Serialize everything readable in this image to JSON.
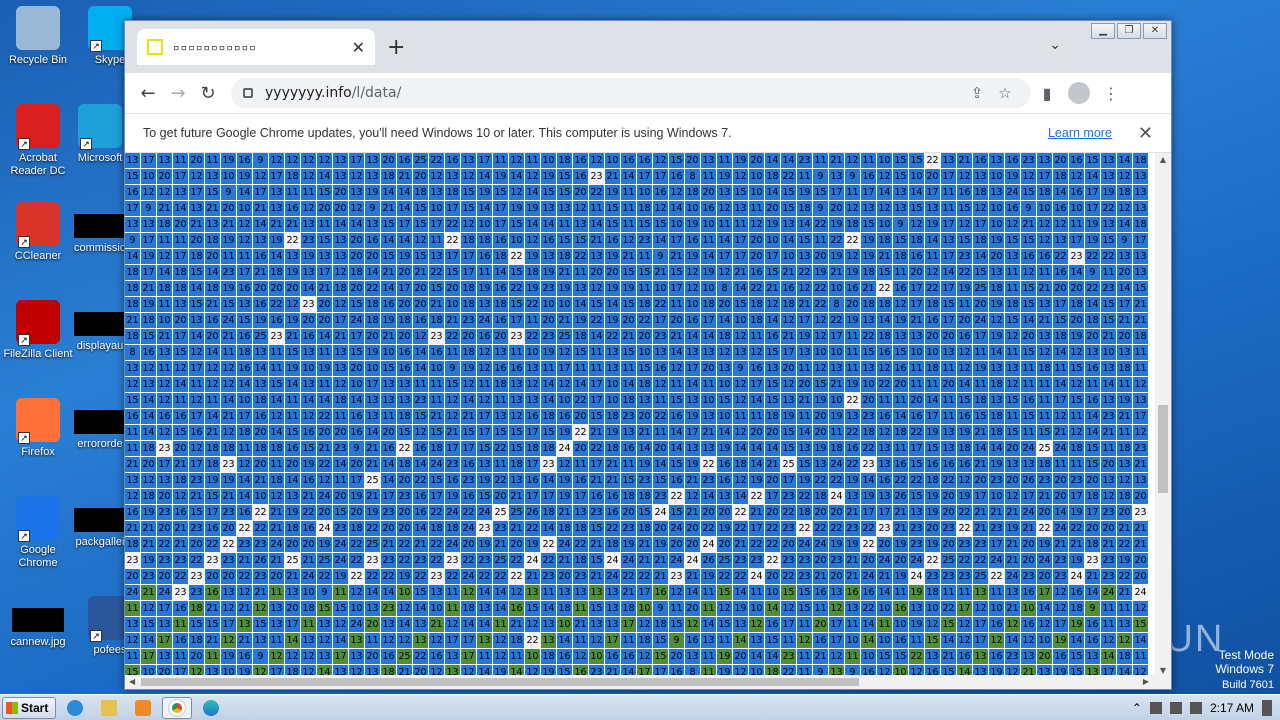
{
  "desktop": {
    "icons": [
      {
        "label": "Recycle Bin",
        "icon": "recycle-bin-icon",
        "color": "#9bb7d6"
      },
      {
        "label": "Skype",
        "icon": "skype-icon",
        "color": "#00aff0"
      },
      {
        "label": "Acrobat Reader DC",
        "icon": "acrobat-icon",
        "color": "#d81e1e"
      },
      {
        "label": "Microsoft",
        "icon": "edge-icon",
        "color": "#1fa0d8"
      },
      {
        "label": "CCleaner",
        "icon": "ccleaner-icon",
        "color": "#d8342a"
      },
      {
        "label": "commissio",
        "icon": "file-icon",
        "color": "#000000"
      },
      {
        "label": "FileZilla Client",
        "icon": "filezilla-icon",
        "color": "#bf0000"
      },
      {
        "label": "displayau",
        "icon": "file-icon",
        "color": "#000000"
      },
      {
        "label": "Firefox",
        "icon": "firefox-icon",
        "color": "#ff7139"
      },
      {
        "label": "errororde",
        "icon": "file-icon",
        "color": "#000000"
      },
      {
        "label": "Google Chrome",
        "icon": "chrome-icon",
        "color": "#1a73e8"
      },
      {
        "label": "packgallei",
        "icon": "file-icon",
        "color": "#000000"
      },
      {
        "label": "cannew.jpg",
        "icon": "file-icon",
        "color": "#000000"
      },
      {
        "label": "pofees",
        "icon": "word-icon",
        "color": "#2b579a"
      }
    ],
    "test_mode": "Test Mode",
    "os_name": "Windows 7",
    "build": "Build 7601",
    "watermark": "ANY RUN"
  },
  "browser": {
    "tab_title": "▫▫▫▫▫▫▫▫▫▫▫",
    "url_host": "yyyyyyy.info",
    "url_path": "/l/data/",
    "infobar_message": "To get future Google Chrome updates, you'll need Windows 10 or later. This computer is using Windows 7.",
    "infobar_link": "Learn more"
  },
  "grid": {
    "columns": 64,
    "rows": 33,
    "colors": {
      "blue": "#2577d9",
      "green": "#4f8f3c",
      "white": "#f3f3f3"
    },
    "row_values": [
      "13 17 13 11 20 11 19 16 9 12 12 12 12 13 17 13 20 16 25 22 16 13 17 11 12 11 10 18 16 12 10 16 16 12 15 20 13 11 19 20 14 14 23 11 21 12 11 10 15 15 22 13 21 16 13 16 23 13 20 16 15 13 14 18",
      "15 10 20 17 12 13 10 19 12 17 18 12 14 13 12 13 18 21 20 12 13 12 14 19 14 12 19 15 16 23 21 14 17 17 16 8 11 19 12 10 18 22 11 9 13 9 16 12",
      "16 12 12 13 17 15 9 14 17 13 11 11 15 20 13 19 14 14 18 13 18 15 19 15 12 14 15 15 20 22 19 11 10 16 12 18 20 13 15 10 14 15 19 15 17 11 17 14 13 14 17 11 16 18 13 24 15 18 14 16 17 19 18 13",
      "17 9 21 14 13 21 20 10 21 13 16 12 20 20 12 9 21 14 15 10 17 15 14 17 19 19 13 13 12 11 15 11 18 12 14 10 16 12 13 11 20 15 18 9 20 12 13 12 13 15 13 11 15 12 10 16 9 10 16 10 17 22 12 13",
      "13 13 18 20 21 13 21 12 14 21 21 13 11 14 14 13 15 17 15 17 22 12 10 17 15 14 14 11 13 14 15 11 15 15 10 19 10 11 11 12 19 13 14 22 19 18 15 10 9 12 19 17 12 17 10 12 21 12 12 11 19 13 14 18",
      "9 17 11 11 20 18 19 12 13 19 22 23 15 13 20 16 14 14 12 11 22 18 18 16 10 12 16 15 15 21 16 12 23 14 17 16 11 14 17 20 10 14 15 11 22 22 19 18 15 18 14 13 15 18 19 15 15 12 13 17 19 15",
      "14 19 12 17 18 20 11 11 16 14 13 19 13 13 20 20 15 19 15 13 17 17 16 18 22 19 13 18 22 13 19 21 11 9 21 19 14 17 17 20 17 10 13 20 19 12 19 21 18 16 11 17 23 14 20 13 16 16 22 23 22 22 13 13",
      "18 17 14 18 15 14 23 17 21 18 19 13 17 12 18 14 21 20 21 22 15 17 11 14 15 18 19 21 11 20 20 15 15 21 15 12 19 12 21 16 15 21 22 19 21 19 18 15 11 20 12 14 22 15 13 11 12 11 16 14 9 11 20 13",
      "18 21 18 18 14 18 19 16 20 20 20 14 21 18 20 22 14 17 20 15 20 18 19 16 22 19 23 19 13 12 19 19 11 10 17 12 10 8 14 22 21 16 12 22 10 16 21 22 16 17 22 17 19 25 18 11 15 21 20 20 22 23 14 15",
      "18 19 11 13 15 21 15 13 16 22 12 23 20 12 15 18 16 20 20 21 10 18 13 18 15 22 10 10 14 15 14 15 18 22 11 10 18 20 15 18 12 18 21 22 8 20 18 18 12 17 18 15 11 20 19 18 15 13 17 18 14 15 17 21",
      "21 18 10 20 13 16 24 15 19 16 19 20 20 17 24 18 19 18 16 18 21 23 24 16 17 11 20 21 19 22 19 20 22 17 20 16 17 14 10 18 14 12 17 12 22 19 13 14 19 21 16 17 20 24 12 15 14 21 15 20 18 15 21",
      "18 15 21 17 14 20 21 16 25 23 21 16 14 21 17 20 21 20 12 23 22 20 16 20 23 22 23 25 18 14 22 21 20 23 21 14 14 18 12 11 16 21 19 12 17 11 22 18 13 13 20 20 16 17 19 12 20 13 18 19 20 21 20",
      "8 16 13 15 12 14 11 18 13 11 15 13 11 13 15 19 10 16 14 16 11 18 12 13 11 10 19 12 15 11 13 15 10 13 14 13 13 12 13 12 15 17 13 10 10 11 15 16 15 10 10 13 12 11 14 11 15 12 14 12 13 10 13 11",
      "13 12 11 12 17 12 12 16 14 11 19 10 19 13 20 10 15 16 14 10 9 19 12 16 16 13 11 17 11 11 13 11 15 16 12 17 20 13 9 16 13 20 11 12 13 11 13 12 16 11 18 11 12 19 13 13 11 18 11 15 16 13 18 11 19 11",
      "12 13 12 14 11 12 12 14 13 15 14 13 11 12 10 17 13 13 11 11 15 12 11 18 13 12 14 12 14 17 10 14 18 12 11 14 11 10 12 17 15 12 20 15 21 19 10 22 20 11 11 20 14 11 18 12 11 11 14 12 11 14 11 12",
      "15 14 12 11 12 11 14 10 18 14 11 14 14 18 14 13 13 13 23 11 12 14 12 11 13 13 14 10 22 17 10 18 13 11 15 13 10 15 12 14 15 13 21 19 10 22 20 11 11 20 14 11 15 18 13 15 16 11 17 15 16 13 19 13",
      "16 14 16 16 17 14 21 17 16 12 11 12 22 11 16 13 11 18 15 21 12 21 17 13 12 16 18 16 20 15 18 23 20 22 16 19 13 10 11 11 18 19 11 20 19 13 23 16 14 16 17 11 16 15 18 11 15 11 12 11 14 23 21 17",
      "11 14 12 15 16 21 12 18 20 14 15 16 20 20 16 14 20 15 12 15 21 15 17 15 15 17 15 19 22 21 19 13 21 11 14 17 21 14 12 20 20 15 14 20 11 22 18 12 18 22 19 13 19 21 18 15 11 15 21 12 14 21 11 12",
      "11 18 23 20 12 18 18 11 18 18 16 15 21 23 9 21 16 22 16 18 17 17 15 22 15 18 18 24 20 22 18 16 14 20 14 13 13 19 14 14 14 15 13 19 18 16 22 13 11 17 15 13 18 14 14 20 24 25 24 18 15",
      "21 20 17 21 17 18 23 12 20 11 20 19 22 14 20 21 14 18 14 24 23 16 13 11 18 17 23 12 11 17 21 11 19 14 15 19 22 16 18 14 21 25 15 13 24 22 23 13 16 15 16 16 16 21 19 13 13 18 11 11 15 20 13",
      "13 12 13 18 23 19 19 14 21 18 14 16 12 11 17 25 14 20 22 15 16 23 19 22 13 16 14 19 16 21 21 15 23 15 16 21 23 16 12 19 20 17 19 22 22 19 14 16 22 22 18 22 12 20 23 20 26 23 20 23 20",
      "12 18 20 12 21 15 21 14 10 12 13 21 24 20 19 21 17 23 16 17 19 16 15 20 21 17 17 19 17 16 16 18 18 23 22 12 14 13 14 22 17 23 22 18 24 13 19 13 26 15 19 20 19 17 10 12 17 21 20 17 18",
      "16 19 23 16 15 17 23 16 22 21 19 22 20 15 20 19 23 20 16 22 24 22 24 25 25 26 18 21 13 23 16 20 15 24 15 21 20 20 22 21 20 22 18 20 20 21 17 17 21 13 19 20 22 21 21 21 24 20 14 19 17 23 20 23",
      "21 21 20 21 23 16 20 22 22 21 18 16 24 23 18 22 20 20 14 18 18 24 23 23 21 22 14 18 18 15 22 23 18 20 24 20 22 19 22 17 22 23 22 22 22 23 22 23 21 23 20 23 22 21 23 19 21 22 24 22 20 20 21",
      "18 21 22 21 20 22 22 23 23 24 20 20 19 24 22 25 21 22 21 22 24 20 19 21 20 19 22 24 22 21 18 19 21 19 20 20 24 20 21 22 22 20 24 24 19 19 22 20 19 23 19 20 23 23 17 21 20 19 21 21",
      "23 19 23 23 22 23 23 21 26 21 25 21 25 24 22 23 23 22 23 22 23 22 23 25 22 24 22 21 18 15 24 24 21 21 24 24 26 25 23 23 22 23 23 20 23 21 20 24 20 24 22 25 22 22 24 21 20 24 23 19 23 23 19 20",
      "20 23 20 22 23 20 20 22 23 20 21 24 22 19 22 22 22 19 22 23 22 24 22 22 22 21 23 20 23 21 24 22 22 21 23 21 19 22 22 24 20 22 23 21 20 21 24 21 19 24 23 23 23 25 22 24 23 20 23 24 21 23 22",
      "24 21 24 23 23 16 13 12 21 11 13 10 9 11 12 14 14 10 15 13 11 12 14 14 12 13 11 13 13 13 13 21 17 16 12 14 11 15 14 11 10 15 15 16 13 16 16 14 11 19 18 11 11 13 11 13 16 17 12 16 14",
      "11 12 17 16 18 21 12 21 12 13 20 18 15 15 10 13 23 12 14 10 11 18 13 14 16 15 14 18 11 15 13 18 10 9 11 20 11 12 19 10 14 12 15 11 12 13 22 10 16 13 10 22 17 12 10 21 10 14 12 18 9 11",
      "13 15 13 11 15 15 17 13 15 13 17 11 13 12 24 20 13 14 13 21 12 14 14 11 21 12 13 10 21 13 13 17 12 18 15 12 14 15 13 12 16 17 11 20 17 11 14 11 10 19 12 15 12 17 16 12 16 12 17 19 16 11",
      "12 14 17 16 18 21 12 21 13 11 14 13 12 14 13 11 12 12 13 12 17 17 13 12 18 22 13 14 11 12 17 11 18 15 9 16 13 11 14 13 15 11 12 16 17 10 14 10 16 11 15 14 12 17 12 14 12 10 19 14 16 12",
      "11 17 13 11 20 11 19 16 9 12 12 12 13 17 13 20 16 25 22 16 13 17 11 12 11 10 18 16 12 10 16 16 12 15 20 13 11 19 20 14 14 23 11 21 12 11 10 15 15 22 13 21 16 13 16 23 13 20 16 15 13 14 18",
      "15 10 20 17 12 13 10 19 12 17 18 12 14 13 12 13 18 21 20 12 13 12 14 19 14 12 19 15 16 23 21 14 17 17 16 8 11 19 12 10 18 22 11 9 13 9 16 12 10 12 16 15 14 13 19 12 21 13 19 15 13 17 14 12"
    ],
    "green_start_row": 27
  },
  "taskbar": {
    "start_label": "Start",
    "time": "2:17 AM",
    "apps": [
      "ie-icon",
      "explorer-icon",
      "media-player-icon",
      "chrome-icon",
      "edge-icon"
    ]
  }
}
